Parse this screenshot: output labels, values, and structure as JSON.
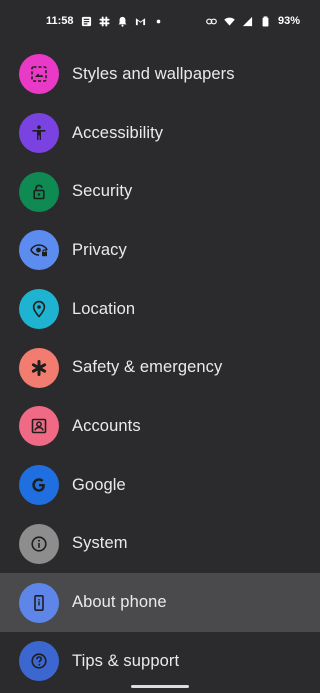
{
  "status_bar": {
    "time": "11:58",
    "battery": "93%",
    "left_icons": [
      "news-icon",
      "slack-icon",
      "bell-icon",
      "gmail-icon",
      "dot-icon"
    ],
    "right_icons": [
      "link-icon",
      "wifi-icon",
      "signal-icon",
      "battery-icon"
    ]
  },
  "settings": {
    "items": [
      {
        "label": "Styles and wallpapers",
        "icon": "palette-frame-icon",
        "color": "#e83ac7"
      },
      {
        "label": "Accessibility",
        "icon": "accessibility-icon",
        "color": "#7a42e0"
      },
      {
        "label": "Security",
        "icon": "lock-icon",
        "color": "#0f8a52"
      },
      {
        "label": "Privacy",
        "icon": "eye-lock-icon",
        "color": "#5d8cf0"
      },
      {
        "label": "Location",
        "icon": "location-pin-icon",
        "color": "#1fb3d2"
      },
      {
        "label": "Safety & emergency",
        "icon": "asterisk-icon",
        "color": "#f37c70"
      },
      {
        "label": "Accounts",
        "icon": "account-box-icon",
        "color": "#f06a86"
      },
      {
        "label": "Google",
        "icon": "google-icon",
        "color": "#1f6fe0"
      },
      {
        "label": "System",
        "icon": "info-icon",
        "color": "#8d8d8d"
      },
      {
        "label": "About phone",
        "icon": "phone-icon",
        "color": "#5d86e8"
      },
      {
        "label": "Tips & support",
        "icon": "help-icon",
        "color": "#3c67d0"
      }
    ]
  }
}
